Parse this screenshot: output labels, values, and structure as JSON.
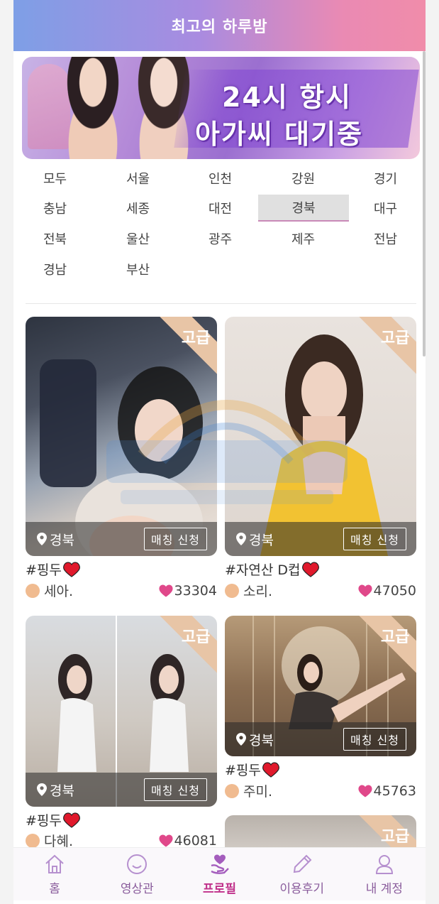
{
  "header": {
    "title": "최고의 하루밤"
  },
  "banner": {
    "line1": "24시 항시",
    "line2": "아가씨 대기중"
  },
  "regions": {
    "items": [
      "모두",
      "서울",
      "인천",
      "강원",
      "경기",
      "충남",
      "세종",
      "대전",
      "경북",
      "대구",
      "전북",
      "울산",
      "광주",
      "제주",
      "전남",
      "경남",
      "부산"
    ],
    "active": "경북"
  },
  "cards": [
    {
      "badge": "고급",
      "location": "경북",
      "button": "매칭 신청",
      "tag": "#핑두",
      "name": "세아.",
      "likes": "33304"
    },
    {
      "badge": "고급",
      "location": "경북",
      "button": "매칭 신청",
      "tag": "#자연산 D컵",
      "name": "소리.",
      "likes": "47050"
    },
    {
      "badge": "고급",
      "location": "경북",
      "button": "매칭 신청",
      "tag": "#핑두",
      "name": "다혜.",
      "likes": "46081"
    },
    {
      "badge": "고급",
      "location": "경북",
      "button": "매칭 신청",
      "tag": "#핑두",
      "name": "주미.",
      "likes": "45763"
    },
    {
      "badge": "고급"
    }
  ],
  "tabbar": {
    "items": [
      {
        "label": "홈",
        "icon": "home-icon"
      },
      {
        "label": "영상관",
        "icon": "smile-icon"
      },
      {
        "label": "프로필",
        "icon": "heart-hand-icon"
      },
      {
        "label": "이용후기",
        "icon": "pencil-icon"
      },
      {
        "label": "내 계정",
        "icon": "user-icon"
      }
    ],
    "active_index": 2
  },
  "colors": {
    "accent": "#c0308a",
    "header_start": "#7e9fe6",
    "header_end": "#f08caa",
    "badge": "#e8c5a6",
    "heart": "#e0488a"
  }
}
